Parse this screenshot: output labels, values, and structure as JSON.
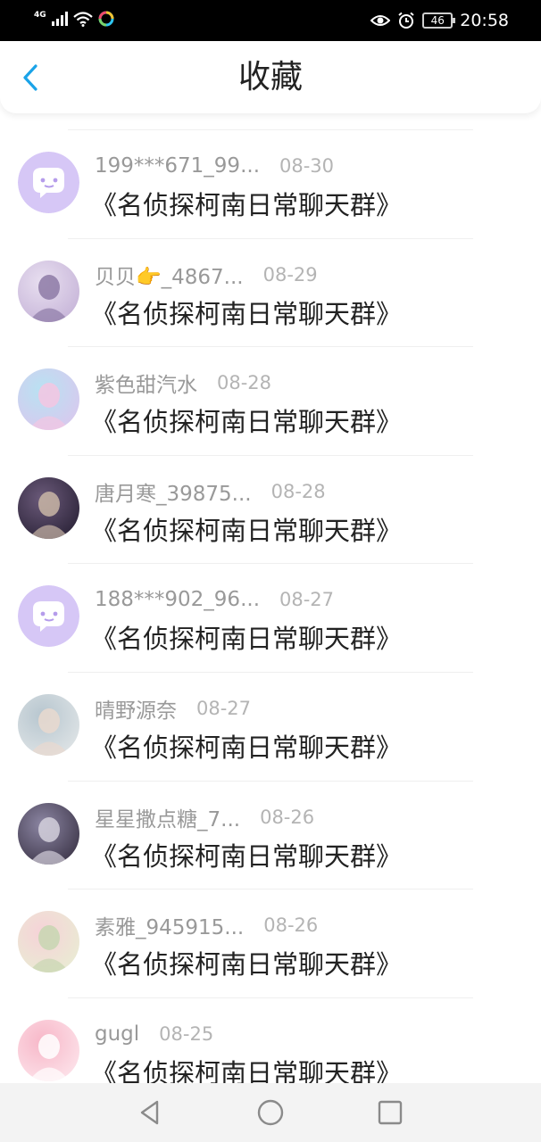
{
  "status_bar": {
    "network": "4G",
    "battery": "46",
    "time": "20:58",
    "icons": [
      "signal-icon",
      "wifi-icon",
      "app-notification-icon",
      "eye-icon",
      "alarm-icon",
      "battery-icon"
    ]
  },
  "header": {
    "title": "收藏",
    "back_icon": "chevron-left-icon",
    "accent_color": "#1aa3e8"
  },
  "favorites": [
    {
      "username": "199***671_99...",
      "date": "08-30",
      "group": "《名侦探柯南日常聊天群》",
      "avatar": "default-chat-avatar"
    },
    {
      "username": "贝贝👉_4867...",
      "date": "08-29",
      "group": "《名侦探柯南日常聊天群》",
      "avatar": "user-avatar"
    },
    {
      "username": "紫色甜汽水",
      "date": "08-28",
      "group": "《名侦探柯南日常聊天群》",
      "avatar": "user-avatar"
    },
    {
      "username": "唐月寒_39875...",
      "date": "08-28",
      "group": "《名侦探柯南日常聊天群》",
      "avatar": "user-avatar"
    },
    {
      "username": "188***902_96...",
      "date": "08-27",
      "group": "《名侦探柯南日常聊天群》",
      "avatar": "default-chat-avatar"
    },
    {
      "username": "晴野源奈",
      "date": "08-27",
      "group": "《名侦探柯南日常聊天群》",
      "avatar": "user-avatar"
    },
    {
      "username": "星星撒点糖_7...",
      "date": "08-26",
      "group": "《名侦探柯南日常聊天群》",
      "avatar": "user-avatar"
    },
    {
      "username": "素雅_945915...",
      "date": "08-26",
      "group": "《名侦探柯南日常聊天群》",
      "avatar": "user-avatar"
    },
    {
      "username": "gugl",
      "date": "08-25",
      "group": "《名侦探柯南日常聊天群》",
      "avatar": "user-avatar"
    }
  ],
  "bottom_nav": [
    "back-triangle-icon",
    "home-circle-icon",
    "recents-square-icon"
  ]
}
